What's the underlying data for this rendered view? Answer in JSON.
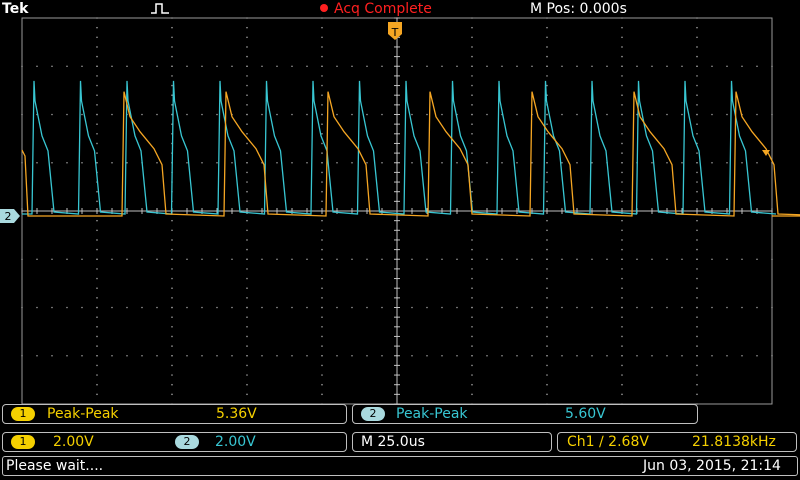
{
  "header": {
    "brand": "Tek",
    "acq_status": "Acq Complete",
    "mpos": "M Pos: 0.000s"
  },
  "channels": {
    "ch1": {
      "number": "1",
      "color": "#f5a623"
    },
    "ch2": {
      "number": "2",
      "color": "#38c6d2"
    }
  },
  "measurements": [
    {
      "channel": "1",
      "label": "Peak-Peak",
      "value": "5.36V"
    },
    {
      "channel": "2",
      "label": "Peak-Peak",
      "value": "5.60V"
    }
  ],
  "settings": {
    "ch1_scale": "2.00V",
    "ch2_scale": "2.00V",
    "timebase": "M 25.0us",
    "trigger": "Ch1 ∕ 2.68V",
    "frequency": "21.8138kHz"
  },
  "status": {
    "message": "Please wait....",
    "datetime": "Jun 03, 2015, 21:14"
  },
  "markers": {
    "trigger_pos": "T",
    "ch2_level": "2"
  },
  "chart_data": {
    "type": "line",
    "time_per_div_us": 25.0,
    "volts_per_div": 2.0,
    "ch1_peak_to_peak_v": 5.36,
    "ch2_peak_to_peak_v": 5.6,
    "ch1_frequency_khz": 21.8138,
    "ch2_pulse_period_div": 0.62,
    "ch1_burst_period_div": 1.36,
    "series": [
      {
        "name": "1",
        "color": "#f5a623"
      },
      {
        "name": "2",
        "color": "#38c6d2"
      }
    ]
  }
}
